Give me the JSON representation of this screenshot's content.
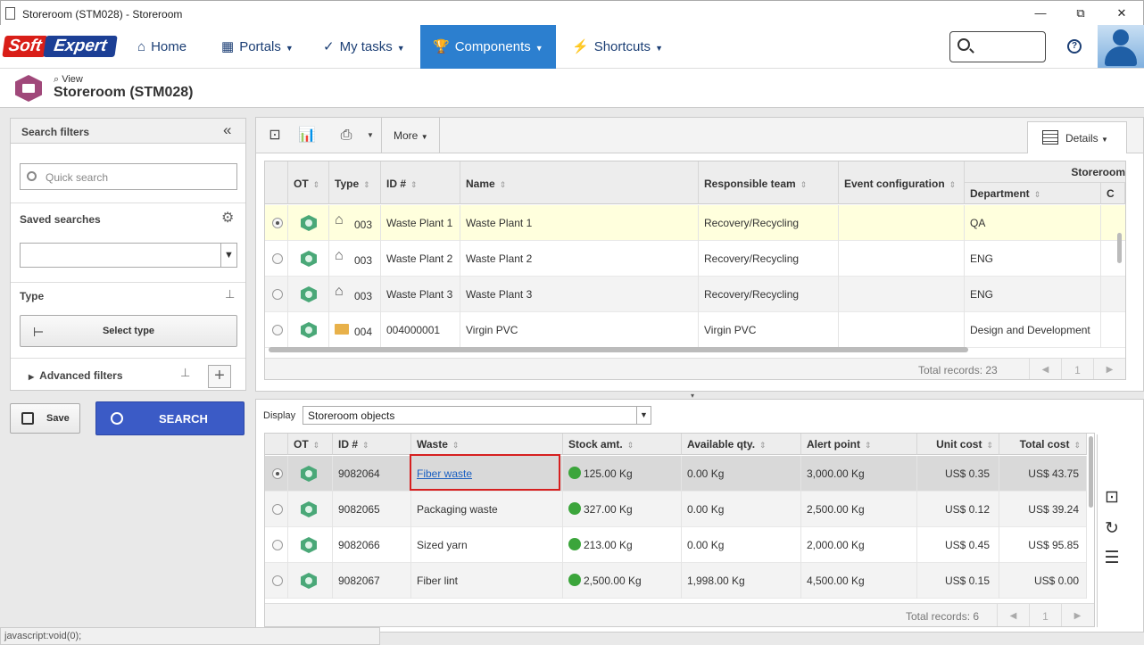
{
  "window": {
    "title": "Storeroom (STM028) - Storeroom",
    "min": "—",
    "max": "⧉",
    "close": "✕"
  },
  "logo": {
    "left": "Soft",
    "right": "Expert"
  },
  "nav": {
    "home": "Home",
    "portals": "Portals",
    "mytasks": "My tasks",
    "components": "Components",
    "shortcuts": "Shortcuts",
    "help": "?"
  },
  "header": {
    "view_label": "View",
    "title": "Storeroom (STM028)"
  },
  "filters": {
    "title": "Search filters",
    "collapse": "«",
    "quick_search_placeholder": "Quick search",
    "saved_searches": "Saved searches",
    "type": "Type",
    "select_type": "Select type",
    "advanced": "Advanced filters",
    "save": "Save",
    "search": "SEARCH"
  },
  "toolbar": {
    "more": "More",
    "details": "Details"
  },
  "top_grid": {
    "columns": [
      "OT",
      "Type",
      "ID #",
      "Name",
      "Responsible team",
      "Event configuration"
    ],
    "group_header": "Storeroom",
    "sub_columns": [
      "Department",
      "C"
    ],
    "rows": [
      {
        "type_code": "003",
        "id": "Waste Plant 1",
        "name": "Waste Plant 1",
        "team": "Recovery/Recycling",
        "event": "",
        "department": "QA",
        "selected": true
      },
      {
        "type_code": "003",
        "id": "Waste Plant 2",
        "name": "Waste Plant 2",
        "team": "Recovery/Recycling",
        "event": "",
        "department": "ENG",
        "selected": false
      },
      {
        "type_code": "003",
        "id": "Waste Plant 3",
        "name": "Waste Plant 3",
        "team": "Recovery/Recycling",
        "event": "",
        "department": "ENG",
        "selected": false
      },
      {
        "type_code": "004",
        "id": "004000001",
        "name": "Virgin PVC",
        "team": "Virgin PVC",
        "event": "",
        "department": "Design and Development",
        "selected": false
      }
    ],
    "total": "Total records: 23",
    "page": "1"
  },
  "bottom": {
    "display_label": "Display",
    "display_value": "Storeroom objects",
    "columns": [
      "OT",
      "ID #",
      "Waste",
      "Stock amt.",
      "Available qty.",
      "Alert point",
      "Unit cost",
      "Total cost"
    ],
    "rows": [
      {
        "id": "9082064",
        "waste": "Fiber waste",
        "stock": "125.00 Kg",
        "available": "0.00 Kg",
        "alert": "3,000.00 Kg",
        "unit": "US$ 0.35",
        "total": "US$ 43.75",
        "selected": true
      },
      {
        "id": "9082065",
        "waste": "Packaging waste",
        "stock": "327.00 Kg",
        "available": "0.00 Kg",
        "alert": "2,500.00 Kg",
        "unit": "US$ 0.12",
        "total": "US$ 39.24",
        "selected": false
      },
      {
        "id": "9082066",
        "waste": "Sized yarn",
        "stock": "213.00 Kg",
        "available": "0.00 Kg",
        "alert": "2,000.00 Kg",
        "unit": "US$ 0.45",
        "total": "US$ 95.85",
        "selected": false
      },
      {
        "id": "9082067",
        "waste": "Fiber lint",
        "stock": "2,500.00 Kg",
        "available": "1,998.00 Kg",
        "alert": "4,500.00 Kg",
        "unit": "US$ 0.15",
        "total": "US$ 0.00",
        "selected": false
      }
    ],
    "total": "Total records: 6",
    "page": "1"
  },
  "status_bar": "javascript:void(0);",
  "colors": {
    "accent": "#2c7fcf",
    "search_button": "#3b5bc6",
    "highlight_row": "#ffffdd",
    "status_green": "#3ba53b",
    "highlight_box": "#d62020"
  }
}
